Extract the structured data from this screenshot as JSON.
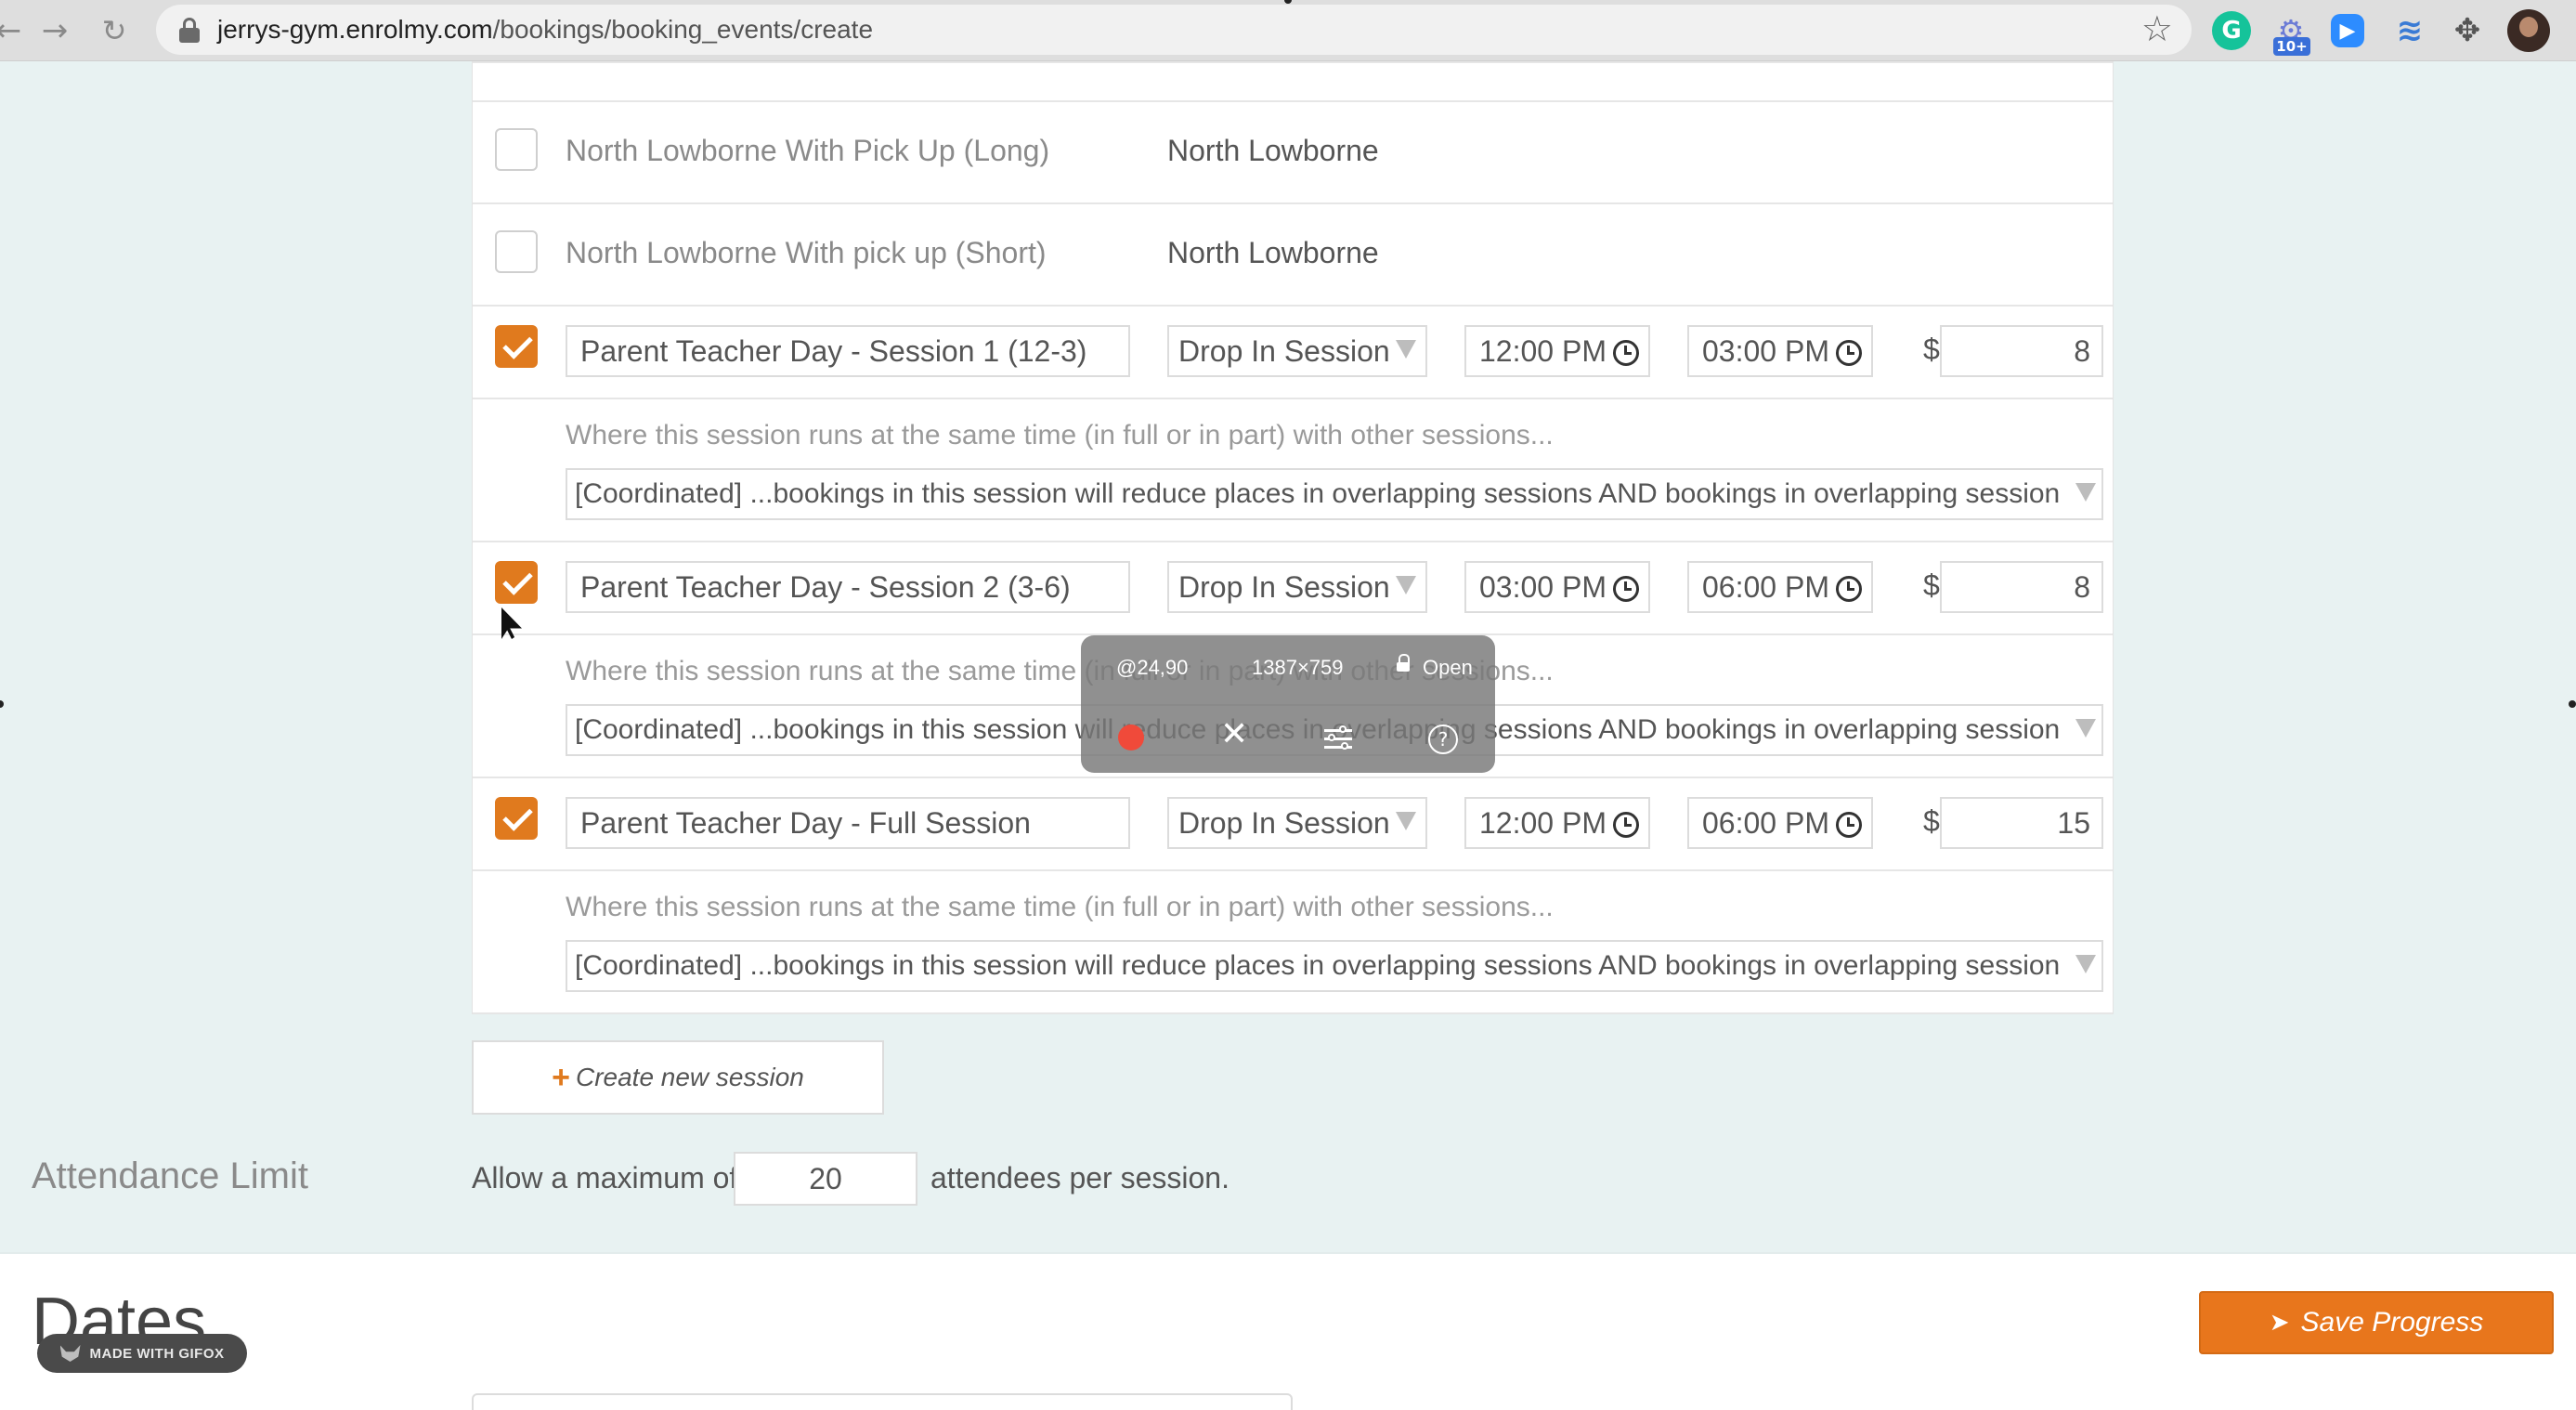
{
  "browser": {
    "url_host": "jerrys-gym.enrolmy.com",
    "url_path": "/bookings/booking_events/create",
    "extension_badge": "10+",
    "grammarly_letter": "G"
  },
  "sessions_list": {
    "plain_rows": [
      {
        "name": "North Lowborne With Pick Up (Long)",
        "location": "North Lowborne",
        "checked": false
      },
      {
        "name": "North Lowborne With pick up (Short)",
        "location": "North Lowborne",
        "checked": false
      }
    ],
    "selected_rows": [
      {
        "name": "Parent Teacher Day - Session 1 (12-3)",
        "type": "Drop In Session",
        "start": "12:00 PM",
        "end": "03:00 PM",
        "currency": "$",
        "price": "8",
        "note": "Where this session runs at the same time (in full or in part) with other sessions...",
        "coordination": "[Coordinated] ...bookings in this session will reduce places in overlapping sessions AND bookings in overlapping session"
      },
      {
        "name": "Parent Teacher Day - Session 2 (3-6)",
        "type": "Drop In Session",
        "start": "03:00 PM",
        "end": "06:00 PM",
        "currency": "$",
        "price": "8",
        "note": "Where this session runs at the same time (in full or in part) with other sessions...",
        "coordination": "[Coordinated] ...bookings in this session will reduce places in overlapping sessions AND bookings in overlapping session"
      },
      {
        "name": "Parent Teacher Day - Full Session",
        "type": "Drop In Session",
        "start": "12:00 PM",
        "end": "06:00 PM",
        "currency": "$",
        "price": "15",
        "note": "Where this session runs at the same time (in full or in part) with other sessions...",
        "coordination": "[Coordinated] ...bookings in this session will reduce places in overlapping sessions AND bookings in overlapping session"
      }
    ],
    "create_label": "Create new session"
  },
  "attendance": {
    "title": "Attendance Limit",
    "prefix": "Allow a maximum of",
    "value": "20",
    "suffix": "attendees per session."
  },
  "dates": {
    "title": "Dates"
  },
  "save_label": "Save Progress",
  "gifox": {
    "badge": "MADE WITH GIFOX",
    "position": "@24,90",
    "size": "1387×759",
    "lock_label": "Open",
    "help": "?"
  },
  "icons": {
    "back": "back-arrow-icon",
    "forward": "forward-arrow-icon",
    "reload": "reload-icon",
    "bookmark": "star-icon",
    "checkbox_checked": "checkmark-icon",
    "time": "clock-icon",
    "add": "plus-icon"
  },
  "colors": {
    "accent": "#e07a1e",
    "save_button": "#e8761c",
    "page_background": "#e8f2f2"
  }
}
